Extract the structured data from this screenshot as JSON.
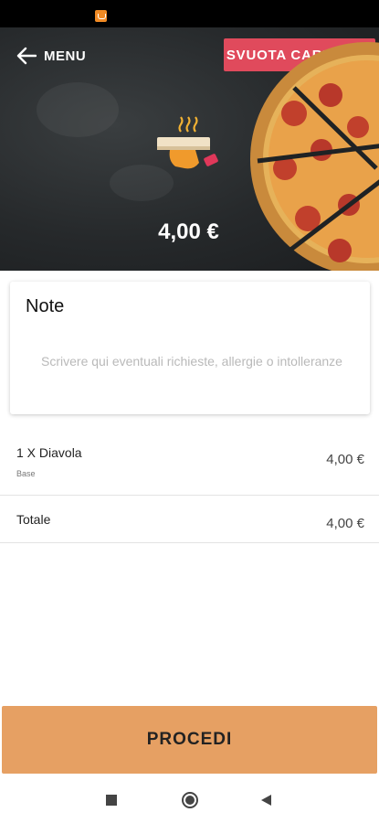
{
  "header": {
    "back_label": "MENU",
    "clear_label": "SVUOTA CARRELLO",
    "total_price": "4,00 €"
  },
  "note": {
    "title": "Note",
    "placeholder": "Scrivere qui eventuali richieste, allergie o intolleranze",
    "value": ""
  },
  "cart": {
    "items": [
      {
        "name": "1 X Diavola",
        "variant": "Base",
        "price": "4,00 €"
      }
    ],
    "total_label": "Totale",
    "total_value": "4,00 €"
  },
  "actions": {
    "proceed_label": "PROCEDI"
  },
  "colors": {
    "accent_red": "#e04a5c",
    "proceed_orange": "#e6a063"
  },
  "icons": {
    "back": "arrow-left-icon",
    "pizza_box": "pizza-box-icon",
    "nav_recent": "nav-square-icon",
    "nav_home": "nav-home-icon",
    "nav_back": "nav-back-icon"
  }
}
